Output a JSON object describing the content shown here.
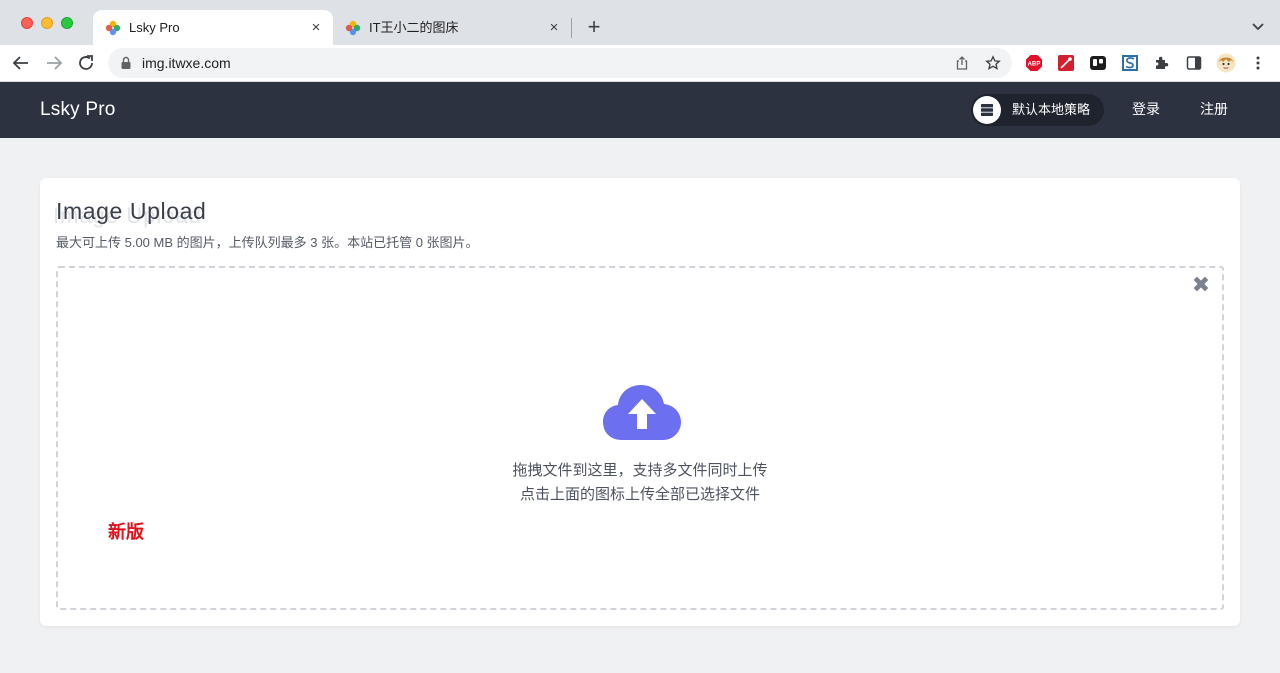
{
  "browser": {
    "tabs": [
      {
        "title": "Lsky Pro",
        "active": true
      },
      {
        "title": "IT王小二的图床",
        "active": false
      }
    ],
    "new_tab_label": "+",
    "close_glyph": "×",
    "address": "img.itwxe.com",
    "extensions": [
      "abp-icon",
      "pdf-icon",
      "trello-icon",
      "s-icon",
      "puzzle-icon",
      "sidepanel-icon",
      "avatar-icon",
      "menu-icon"
    ]
  },
  "site": {
    "brand": "Lsky Pro",
    "strategy_label": "默认本地策略",
    "login": "登录",
    "register": "注册"
  },
  "upload": {
    "title": "Image Upload",
    "subtitle": "最大可上传 5.00 MB 的图片，上传队列最多 3 张。本站已托管 0 张图片。",
    "close_glyph": "✖",
    "drop_line1": "拖拽文件到这里，支持多文件同时上传",
    "drop_line2": "点击上面的图标上传全部已选择文件",
    "new_badge": "新版"
  },
  "colors": {
    "navbar": "#2d3240",
    "accent_cloud": "#6c6ff0",
    "badge_red": "#e0141e"
  }
}
